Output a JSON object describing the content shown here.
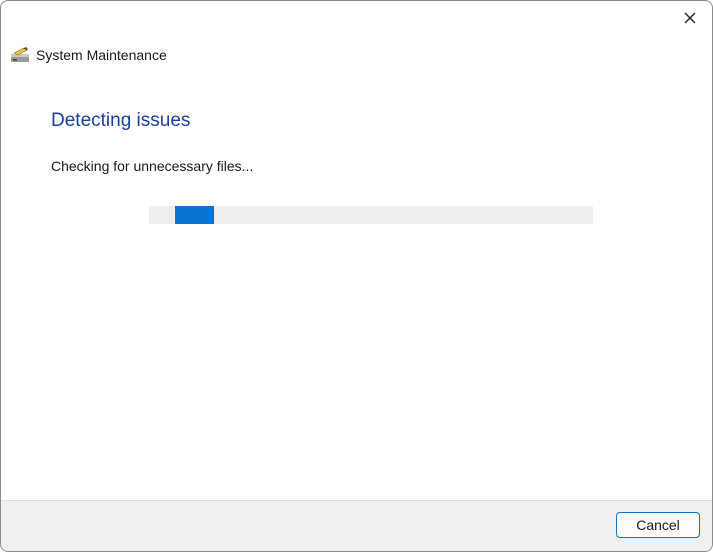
{
  "window": {
    "title": "System Maintenance",
    "icon": "disk-cleanup-icon",
    "close_icon": "close-icon"
  },
  "main": {
    "heading": "Detecting issues",
    "status": "Checking for unnecessary files...",
    "progress": {
      "mode": "indeterminate",
      "chunk_start_fraction": 0.059,
      "chunk_width_fraction": 0.088,
      "fill_color": "#0a74d4",
      "track_color": "#eeeeee"
    }
  },
  "footer": {
    "cancel_label": "Cancel"
  },
  "colors": {
    "heading": "#1d3f97",
    "accent": "#1a6ec4"
  }
}
